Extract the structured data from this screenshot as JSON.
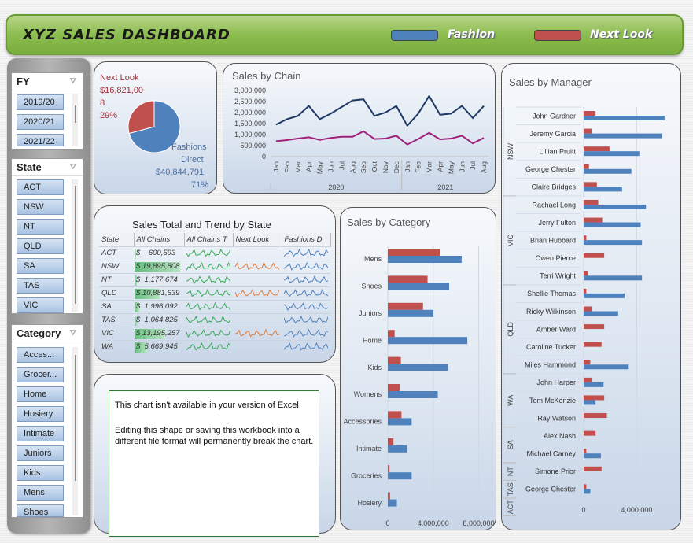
{
  "header": {
    "title": "XYZ SALES DASHBOARD",
    "legend": [
      {
        "label": "Fashion",
        "color": "#4f81bd"
      },
      {
        "label": "Next Look",
        "color": "#c0504d"
      }
    ]
  },
  "slicers": {
    "fy": {
      "title": "FY",
      "items": [
        "2019/20",
        "2020/21",
        "2021/22"
      ]
    },
    "state": {
      "title": "State",
      "items": [
        "ACT",
        "NSW",
        "NT",
        "QLD",
        "SA",
        "TAS",
        "VIC"
      ]
    },
    "category": {
      "title": "Category",
      "items": [
        "Acces...",
        "Grocer...",
        "Home",
        "Hosiery",
        "Intimate",
        "Juniors",
        "Kids",
        "Mens",
        "Shoes"
      ]
    }
  },
  "pie": {
    "next_label": "Next Look",
    "next_value": "$16,821,00",
    "next_value2": "8",
    "next_pct": "29%",
    "fd_label1": "Fashions",
    "fd_label2": "Direct",
    "fd_value": "$40,844,791",
    "fd_pct": "71%"
  },
  "chain": {
    "title": "Sales by Chain",
    "yticks": [
      "3,000,000",
      "2,500,000",
      "2,000,000",
      "1,500,000",
      "1,000,000",
      "500,000",
      "0"
    ],
    "months": [
      "Jan",
      "Feb",
      "Mar",
      "Apr",
      "May",
      "Jun",
      "Jul",
      "Aug",
      "Sep",
      "Oct",
      "Nov",
      "Dec",
      "Jan",
      "Feb",
      "Mar",
      "Apr",
      "May",
      "Jun",
      "Jul",
      "Aug"
    ],
    "years": [
      "2020",
      "2021"
    ]
  },
  "state_table": {
    "title": "Sales Total and Trend by State",
    "headers": [
      "State",
      "All Chains",
      "All Chains T",
      "Next Look",
      "Fashions D"
    ],
    "rows": [
      {
        "state": "ACT",
        "dollar": "$",
        "value": "600,593",
        "bar": 0.03,
        "next": false
      },
      {
        "state": "NSW",
        "dollar": "$",
        "value": "19,895,808",
        "bar": 1.0,
        "next": true
      },
      {
        "state": "NT",
        "dollar": "$",
        "value": "1,177,674",
        "bar": 0.06,
        "next": false
      },
      {
        "state": "QLD",
        "dollar": "$",
        "value": "10,881,639",
        "bar": 0.55,
        "next": true
      },
      {
        "state": "SA",
        "dollar": "$",
        "value": "1,996,092",
        "bar": 0.1,
        "next": false
      },
      {
        "state": "TAS",
        "dollar": "$",
        "value": "1,064,825",
        "bar": 0.05,
        "next": false
      },
      {
        "state": "VIC",
        "dollar": "$",
        "value": "13,195,257",
        "bar": 0.66,
        "next": true
      },
      {
        "state": "WA",
        "dollar": "$",
        "value": "5,669,945",
        "bar": 0.28,
        "next": false
      }
    ]
  },
  "unavailable": {
    "line1": "This chart isn't available in your version of Excel.",
    "line2": "Editing this shape or saving this workbook into a different file format will permanently break the chart."
  },
  "category_chart": {
    "title": "Sales by Category",
    "xticks": [
      "0",
      "4,000,000",
      "8,000,000"
    ]
  },
  "manager_chart": {
    "title": "Sales by Manager",
    "xticks": [
      "0",
      "4,000,000"
    ],
    "groups": [
      {
        "state": "NSW",
        "count": 5
      },
      {
        "state": "VIC",
        "count": 5
      },
      {
        "state": "QLD",
        "count": 5
      },
      {
        "state": "WA",
        "count": 3
      },
      {
        "state": "SA",
        "count": 2
      },
      {
        "state": "NT",
        "count": 1
      },
      {
        "state": "TAS",
        "count": 1
      },
      {
        "state": "ACT",
        "count": 1
      }
    ]
  },
  "chart_data": [
    {
      "type": "line",
      "title": "Sales by Chain",
      "x": [
        "Jan 2020",
        "Feb 2020",
        "Mar 2020",
        "Apr 2020",
        "May 2020",
        "Jun 2020",
        "Jul 2020",
        "Aug 2020",
        "Sep 2020",
        "Oct 2020",
        "Nov 2020",
        "Dec 2020",
        "Jan 2021",
        "Feb 2021",
        "Mar 2021",
        "Apr 2021",
        "May 2021",
        "Jun 2021",
        "Jul 2021",
        "Aug 2021"
      ],
      "ylim": [
        0,
        3000000
      ],
      "series": [
        {
          "name": "Fashion",
          "color": "#1f3864",
          "values": [
            1450000,
            1700000,
            1850000,
            2300000,
            1700000,
            1950000,
            2250000,
            2550000,
            2600000,
            1850000,
            2000000,
            2300000,
            1400000,
            1950000,
            2750000,
            1900000,
            1950000,
            2300000,
            1750000,
            2300000
          ]
        },
        {
          "name": "Next Look",
          "color": "#a0207a",
          "values": [
            700000,
            750000,
            820000,
            880000,
            760000,
            850000,
            900000,
            900000,
            1150000,
            800000,
            820000,
            950000,
            550000,
            800000,
            1080000,
            780000,
            820000,
            950000,
            600000,
            850000
          ]
        }
      ]
    },
    {
      "type": "bar",
      "title": "Sales by Category",
      "categories": [
        "Mens",
        "Shoes",
        "Juniors",
        "Home",
        "Kids",
        "Womens",
        "Accessories",
        "Intimate",
        "Groceries",
        "Hosiery"
      ],
      "xlim": [
        0,
        9000000
      ],
      "series": [
        {
          "name": "Next Look",
          "color": "#c0504d",
          "values": [
            4600000,
            3500000,
            3100000,
            600000,
            1150000,
            1050000,
            1200000,
            500000,
            150000,
            200000
          ]
        },
        {
          "name": "Fashion",
          "color": "#4f81bd",
          "values": [
            6500000,
            5400000,
            4000000,
            7000000,
            5300000,
            4400000,
            2100000,
            1700000,
            2100000,
            800000
          ]
        }
      ]
    },
    {
      "type": "bar",
      "title": "Sales by Manager",
      "categories": [
        "John Gardner",
        "Jeremy Garcia",
        "Lillian Pruitt",
        "George Chester",
        "Claire Bridges",
        "Rachael Long",
        "Jerry Fulton",
        "Brian Hubbard",
        "Owen Pierce",
        "Terri Wright",
        "Shellie Thomas",
        "Ricky Wilkinson",
        "Amber Ward",
        "Caroline Tucker",
        "Miles Hammond",
        "John Harper",
        "Tom McKenzie",
        "Ray Watson",
        "Alex Nash",
        "Michael Carney",
        "Simone Prior",
        "George Chester"
      ],
      "xlim": [
        0,
        7000000
      ],
      "series": [
        {
          "name": "Next Look",
          "color": "#c0504d",
          "values": [
            900000,
            600000,
            1950000,
            400000,
            1000000,
            1100000,
            1400000,
            200000,
            1550000,
            300000,
            200000,
            600000,
            1550000,
            1350000,
            500000,
            600000,
            1550000,
            1750000,
            900000,
            200000,
            1350000,
            200000
          ]
        },
        {
          "name": "Fashion",
          "color": "#4f81bd",
          "values": [
            6100000,
            5900000,
            4200000,
            3600000,
            2900000,
            4700000,
            4300000,
            4400000,
            0,
            4400000,
            3100000,
            2600000,
            0,
            0,
            3400000,
            1500000,
            900000,
            0,
            0,
            1300000,
            0,
            500000
          ]
        }
      ]
    },
    {
      "type": "pie",
      "title": "",
      "categories": [
        "Next Look",
        "Fashions Direct"
      ],
      "values": [
        16821008,
        40844791
      ]
    }
  ]
}
